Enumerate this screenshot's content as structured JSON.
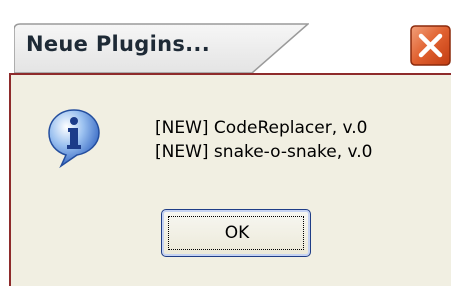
{
  "window": {
    "title": "Neue Plugins...",
    "close_icon": "close-icon"
  },
  "dialog": {
    "icon": "info-icon",
    "messages": [
      "[NEW]  CodeReplacer, v.0",
      "[NEW]  snake-o-snake, v.0"
    ],
    "ok_label": "OK"
  },
  "colors": {
    "frame_border": "#8e2b2b",
    "dialog_background": "#f1efe2",
    "close_button": "#e0602f",
    "button_border": "#1f3d86"
  }
}
